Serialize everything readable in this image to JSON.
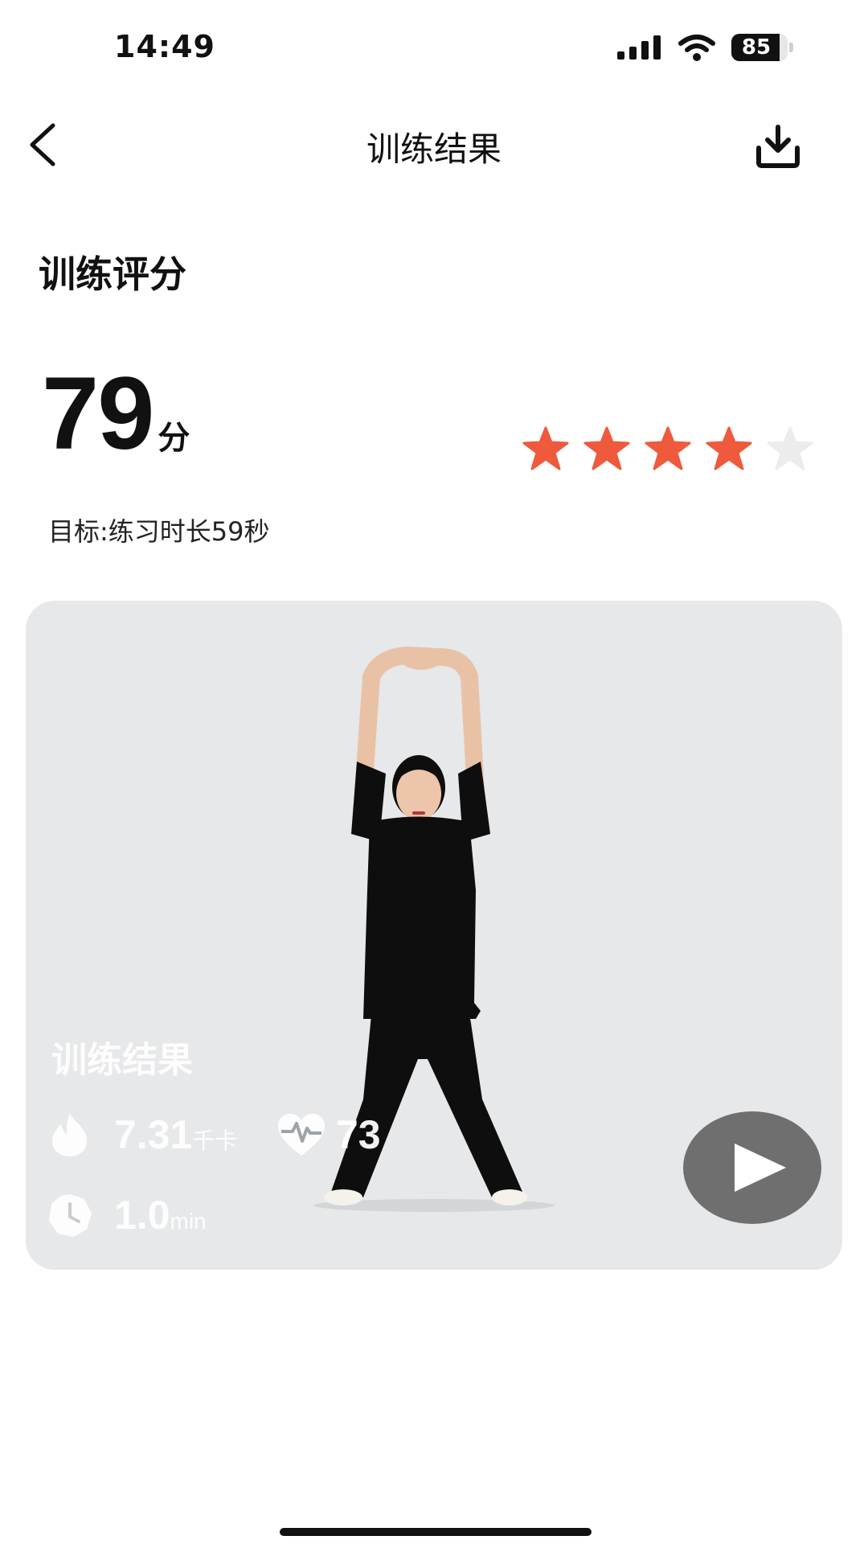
{
  "status_bar": {
    "time": "14:49",
    "battery": "85",
    "battery_level": 0.85
  },
  "nav": {
    "title": "训练结果",
    "back_icon": "chevron-left-icon",
    "download_icon": "download-icon"
  },
  "score_section": {
    "title": "训练评分",
    "score": "79",
    "unit": "分",
    "rating": 4,
    "rating_max": 5,
    "goal": "目标:练习时长59秒"
  },
  "colors": {
    "star_active": "#ef5a3c",
    "star_inactive": "#ececec",
    "card_bg": "#e6e8ea",
    "play_bg": "#6f6f6f"
  },
  "result_card": {
    "title": "训练结果",
    "calories_value": "7.31",
    "calories_unit": "千卡",
    "heart_rate": "73",
    "duration_value": "1.0",
    "duration_unit": "min",
    "icons": [
      "flame-icon",
      "heart-pulse-icon",
      "clock-icon",
      "play-icon"
    ]
  }
}
